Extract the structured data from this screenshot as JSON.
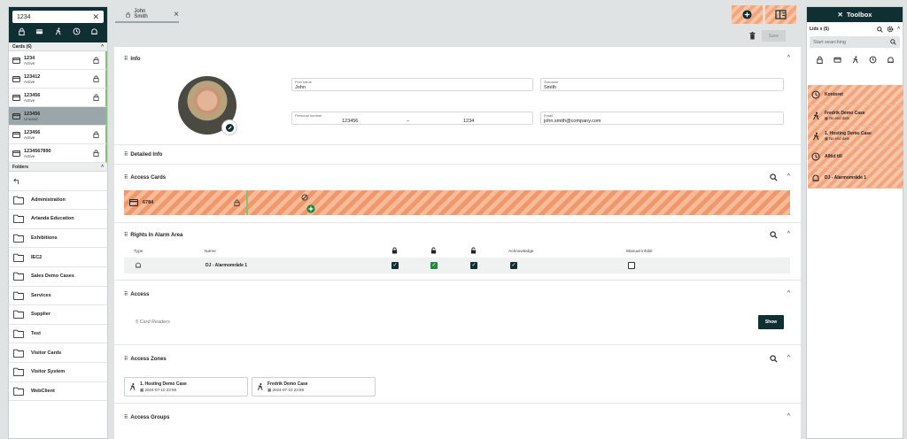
{
  "left": {
    "search_value": "1234",
    "cards_header": "Cards (6)",
    "cards": [
      {
        "number": "1234",
        "status": "Active",
        "selected": false
      },
      {
        "number": "123412",
        "status": "Active",
        "selected": false
      },
      {
        "number": "123456",
        "status": "Active",
        "selected": false
      },
      {
        "number": "123456",
        "status": "Unused",
        "selected": true
      },
      {
        "number": "123456",
        "status": "Active",
        "selected": false
      },
      {
        "number": "1234567890",
        "status": "Active",
        "selected": false
      }
    ],
    "folders_header": "Folders",
    "folders": [
      "Administration",
      "Arlanda Education",
      "Exhibitions",
      "IEC2",
      "Sales Demo Cases",
      "Services",
      "Supplier",
      "Test",
      "Visitor Cards",
      "Visitor System",
      "WebClient"
    ]
  },
  "tab": {
    "label": "John Smith"
  },
  "actions": {
    "save_label": "Save"
  },
  "info": {
    "title": "Info",
    "first_name_label": "First name",
    "first_name": "John",
    "surname_label": "Surname",
    "surname": "Smith",
    "personal_number_label": "Personal number",
    "personal_number_a": "123456",
    "personal_number_sep": "–",
    "personal_number_b": "1234",
    "email_label": "Email",
    "email": "john.smith@company.com"
  },
  "detailed_info": {
    "title": "Detailed Info"
  },
  "access_cards": {
    "title": "Access Cards",
    "card": "6784"
  },
  "rights": {
    "title": "Rights In Alarm Area",
    "col_type": "Type",
    "col_name": "Name",
    "col_ack": "Acknowledge",
    "col_manual": "Manual inhibit",
    "row_name": "DJ - Alarmområde 1"
  },
  "access": {
    "title": "Access",
    "readers": "5 Card Readers",
    "show_label": "Show"
  },
  "access_zones": {
    "title": "Access Zones",
    "zones": [
      {
        "name": "1. Hosting Demo Case",
        "date": "2024-07-10 23:59"
      },
      {
        "name": "Fredrik Demo Case",
        "date": "2024-07-10 23:59"
      }
    ]
  },
  "access_groups": {
    "title": "Access Groups"
  },
  "toolbox": {
    "title": "Toolbox",
    "subheader": "Lids x (5)",
    "search_placeholder": "Start searching",
    "items": [
      {
        "title": "Kontoret",
        "sub": "",
        "icon": "clock-icon"
      },
      {
        "title": "Fredrik Demo Case",
        "sub": "No end date",
        "icon": "person-walking-icon"
      },
      {
        "title": "1. Hosting Demo Case",
        "sub": "No end date",
        "icon": "person-walking-icon"
      },
      {
        "title": "Alltid till",
        "sub": "",
        "icon": "clock-icon"
      },
      {
        "title": "DJ - Alarmområde 1",
        "sub": "",
        "icon": "alarm-bell-icon"
      }
    ]
  },
  "colors": {
    "dark": "#0f2f33",
    "accent_hatch": "#f3a57d",
    "active_green": "#88c078",
    "check_green": "#1c8a3f"
  }
}
